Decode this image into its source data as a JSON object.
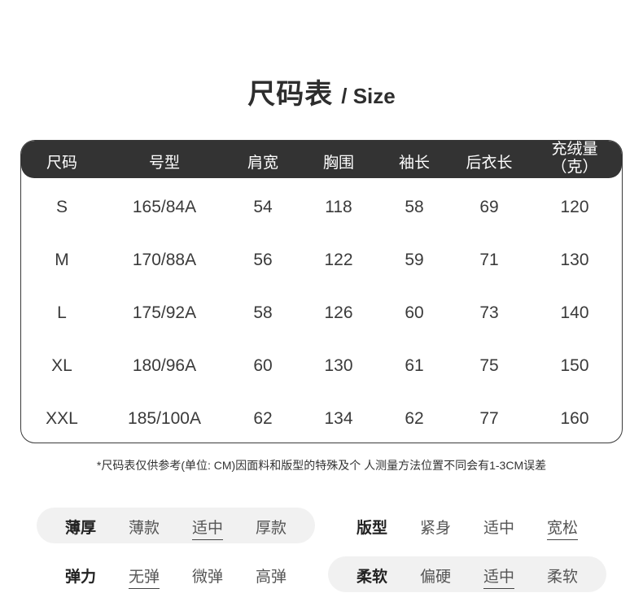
{
  "title": {
    "cn": "尺码表",
    "en": "/ Size"
  },
  "table": {
    "headers": [
      "尺码",
      "号型",
      "肩宽",
      "胸围",
      "袖长",
      "后衣长",
      "充绒量",
      "（克）"
    ],
    "rows": [
      [
        "S",
        "165/84A",
        "54",
        "118",
        "58",
        "69",
        "120"
      ],
      [
        "M",
        "170/88A",
        "56",
        "122",
        "59",
        "71",
        "130"
      ],
      [
        "L",
        "175/92A",
        "58",
        "126",
        "60",
        "73",
        "140"
      ],
      [
        "XL",
        "180/96A",
        "60",
        "130",
        "61",
        "75",
        "150"
      ],
      [
        "XXL",
        "185/100A",
        "62",
        "134",
        "62",
        "77",
        "160"
      ]
    ]
  },
  "note": "*尺码表仅供参考(单位: CM)因面料和版型的特殊及个 人测量方法位置不同会有1-3CM误差",
  "attributes": {
    "thickness": {
      "label": "薄厚",
      "options": [
        "薄款",
        "适中",
        "厚款"
      ],
      "selected": "适中"
    },
    "fit": {
      "label": "版型",
      "options": [
        "紧身",
        "适中",
        "宽松"
      ],
      "selected": "宽松"
    },
    "elasticity": {
      "label": "弹力",
      "options": [
        "无弹",
        "微弹",
        "高弹"
      ],
      "selected": "无弹"
    },
    "softness": {
      "label": "柔软",
      "options": [
        "偏硬",
        "适中",
        "柔软"
      ],
      "selected": "适中"
    }
  },
  "colors": {
    "header_bg": "#333333",
    "pill_bg": "#f1f1f1",
    "text": "#333333"
  }
}
